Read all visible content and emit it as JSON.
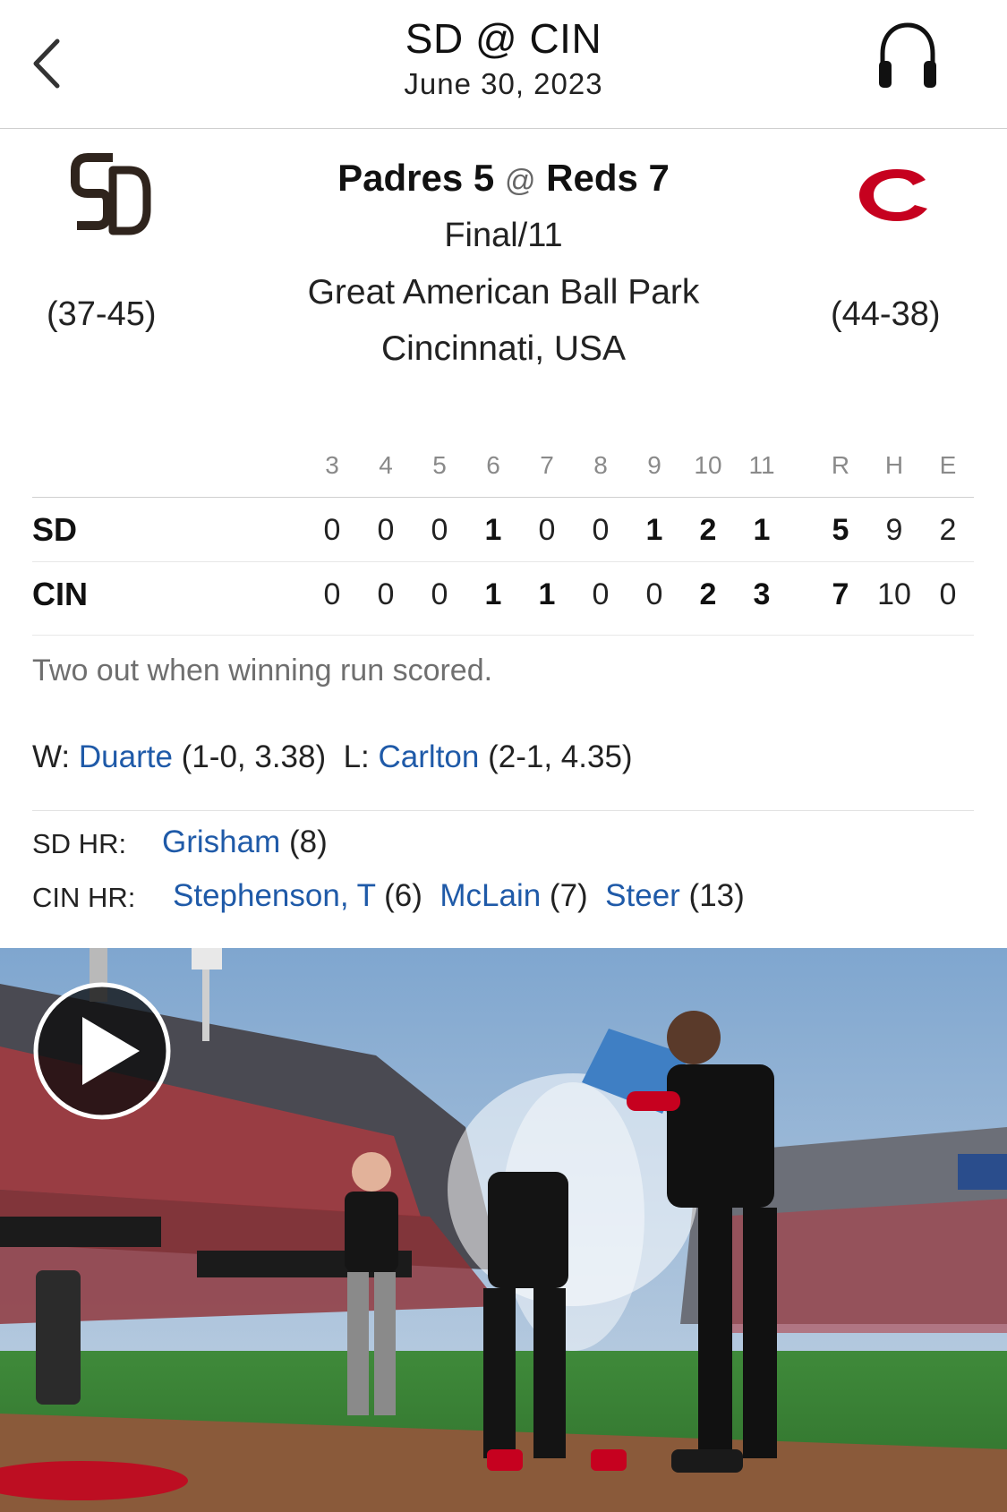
{
  "header": {
    "title": "SD @ CIN",
    "date": "June 30, 2023"
  },
  "matchup": {
    "away_name": "Padres",
    "away_score": "5",
    "at": "@",
    "home_name": "Reds",
    "home_score": "7",
    "status": "Final/11",
    "venue": "Great American Ball Park",
    "city": "Cincinnati, USA",
    "away_record": "(37-45)",
    "home_record": "(44-38)"
  },
  "linescore": {
    "columns": [
      "3",
      "4",
      "5",
      "6",
      "7",
      "8",
      "9",
      "10",
      "11",
      "R",
      "H",
      "E"
    ],
    "rows": [
      {
        "team": "SD",
        "cells": [
          "0",
          "0",
          "0",
          "1",
          "0",
          "0",
          "1",
          "2",
          "1",
          "5",
          "9",
          "2"
        ]
      },
      {
        "team": "CIN",
        "cells": [
          "0",
          "0",
          "0",
          "1",
          "1",
          "0",
          "0",
          "2",
          "3",
          "7",
          "10",
          "0"
        ]
      }
    ]
  },
  "note": "Two out when winning run scored.",
  "decisions": {
    "win_label": "W:",
    "win_pitcher": "Duarte",
    "win_stats": "(1-0, 3.38)",
    "loss_label": "L:",
    "loss_pitcher": "Carlton",
    "loss_stats": "(2-1, 4.35)"
  },
  "home_runs": {
    "sd_label": "SD HR:",
    "sd": [
      {
        "name": "Grisham",
        "count": "(8)"
      }
    ],
    "cin_label": "CIN HR:",
    "cin": [
      {
        "name": "Stephenson, T",
        "count": "(6)"
      },
      {
        "name": "McLain",
        "count": "(7)"
      },
      {
        "name": "Steer",
        "count": "(13)"
      }
    ]
  },
  "colors": {
    "link": "#1f5aa8",
    "reds_red": "#c6011f",
    "padres_brown": "#2f241d"
  },
  "icons": {
    "back": "chevron-left-icon",
    "audio": "headphones-icon",
    "play": "play-icon"
  }
}
